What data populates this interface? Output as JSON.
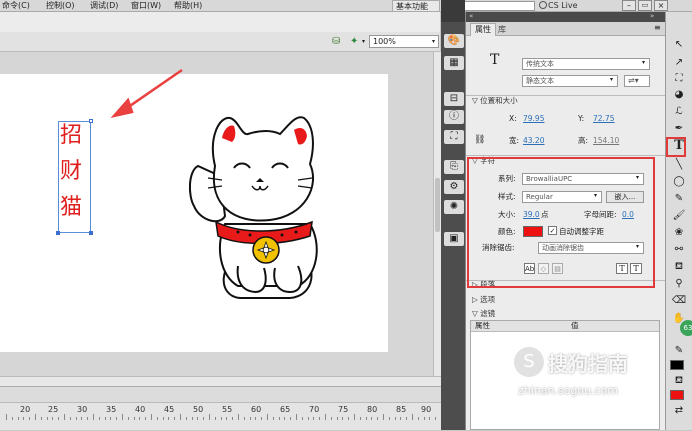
{
  "menubar": {
    "items": [
      "命令(C)",
      "控制(O)",
      "调试(D)",
      "窗口(W)",
      "帮助(H)"
    ],
    "workspace": "基本功能",
    "search_label": "CS Live"
  },
  "stage": {
    "zoom": "100%",
    "vertical_text": [
      "招",
      "财",
      "猫"
    ]
  },
  "timeline": {
    "ruler_labels": [
      "20",
      "25",
      "30",
      "35",
      "40",
      "45",
      "50",
      "55",
      "60",
      "65",
      "70",
      "75",
      "80",
      "85",
      "90"
    ]
  },
  "properties": {
    "tabs": [
      "属性",
      "库"
    ],
    "text_type": "传统文本",
    "text_subtype": "静态文本",
    "position_section": "位置和大小",
    "x_label": "X:",
    "x_value": "79.95",
    "y_label": "Y:",
    "y_value": "72.75",
    "width_label": "宽:",
    "width_value": "43.20",
    "height_label": "高:",
    "height_value": "154.10",
    "char_section": "字符",
    "family_label": "系列:",
    "family_value": "BrowalliaUPC",
    "style_label": "样式:",
    "style_value": "Regular",
    "embed_label": "嵌入...",
    "size_label": "大小:",
    "size_value": "39.0",
    "size_unit": "点",
    "spacing_label": "字母间距:",
    "spacing_value": "0.0",
    "color_label": "颜色:",
    "text_color": "#ee1111",
    "auto_kern": "自动调整字距",
    "antialias_label": "消除锯齿:",
    "antialias_value": "动画消除锯齿",
    "paragraph_section": "段落",
    "options_section": "选项",
    "filter_section": "滤镜",
    "filter_col_prop": "属性",
    "filter_col_val": "值"
  },
  "watermark": {
    "brand": "搜狗指南",
    "url": "zhinan.sogou.com"
  },
  "badge": "63"
}
